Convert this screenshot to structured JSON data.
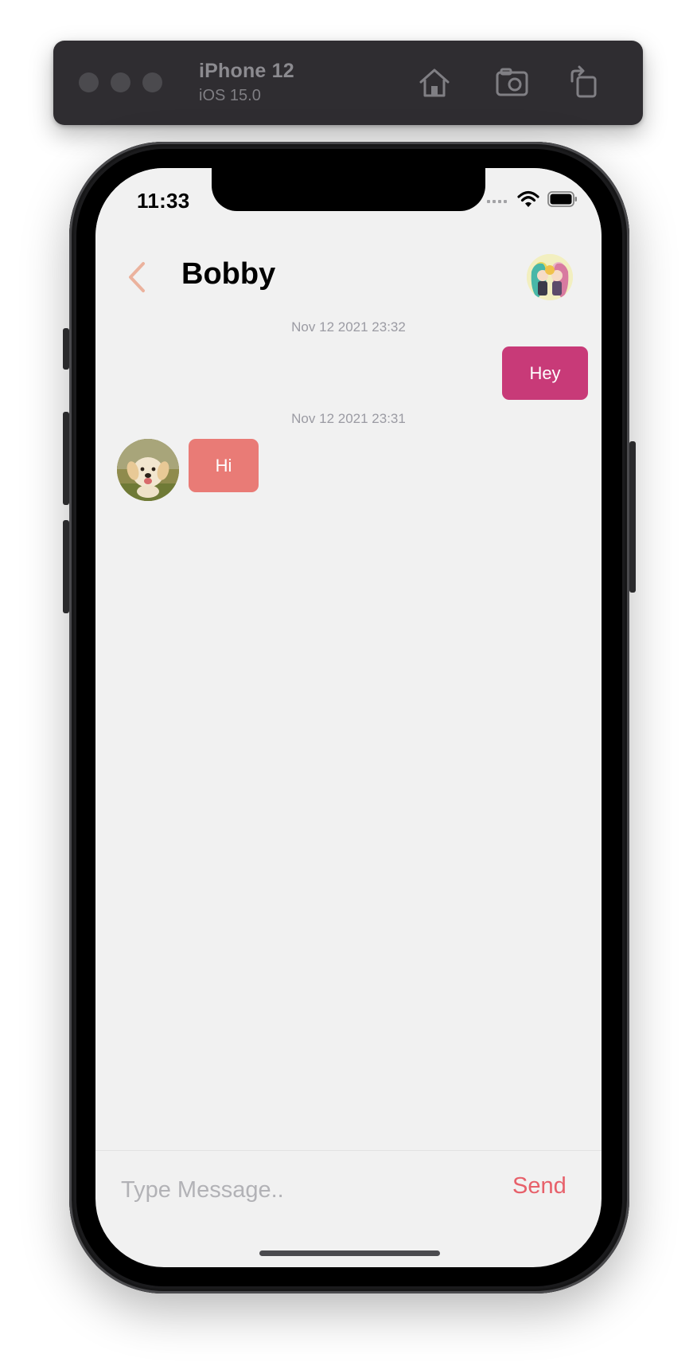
{
  "simulator": {
    "device_name": "iPhone 12",
    "os_version": "iOS 15.0",
    "icons": [
      "home-icon",
      "screenshot-icon",
      "rotate-icon"
    ]
  },
  "status_bar": {
    "time": "11:33",
    "icons": [
      "cellular-icon",
      "wifi-icon",
      "battery-icon"
    ]
  },
  "chat": {
    "contact_name": "Bobby",
    "messages": [
      {
        "direction": "outgoing",
        "timestamp": "Nov 12 2021 23:32",
        "text": "Hey"
      },
      {
        "direction": "incoming",
        "timestamp": "Nov 12 2021 23:31",
        "text": "Hi"
      }
    ]
  },
  "composer": {
    "placeholder": "Type Message..",
    "value": "",
    "send_label": "Send"
  },
  "colors": {
    "outgoing_bubble": "#c83a78",
    "incoming_bubble": "#e97b76",
    "send_button": "#e7606a",
    "back_chevron": "#ebb29d",
    "screen_background": "#f1f1f1"
  }
}
